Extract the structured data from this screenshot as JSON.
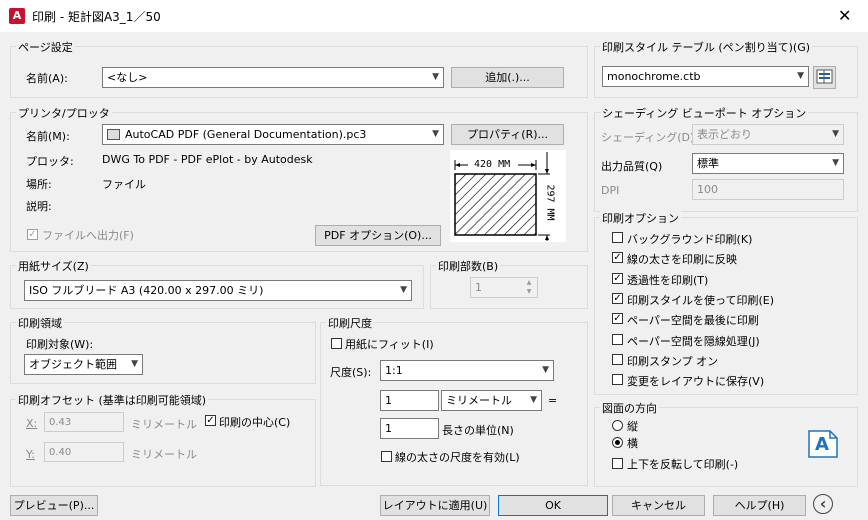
{
  "window": {
    "title": "印刷 - 矩計図A3_1／50",
    "icon_letter": "A",
    "close_glyph": "✕"
  },
  "page_setup": {
    "title": "ページ設定",
    "name_label": "名前(A):",
    "name_value": "<なし>",
    "add_button": "追加(.)..."
  },
  "printer": {
    "title": "プリンタ/プロッタ",
    "name_label": "名前(M):",
    "name_value": "AutoCAD PDF (General Documentation).pc3",
    "properties_button": "プロパティ(R)...",
    "plotter_label": "プロッタ:",
    "plotter_value": "DWG To PDF - PDF ePlot - by Autodesk",
    "location_label": "場所:",
    "location_value": "ファイル",
    "description_label": "説明:",
    "print_to_file_label": "ファイルへ出力(F)",
    "print_to_file_checked": true,
    "pdf_options_button": "PDF オプション(O)...",
    "preview_width": "420 MM",
    "preview_height": "297 MM"
  },
  "paper_size": {
    "title": "用紙サイズ(Z)",
    "value": "ISO フルブリード A3 (420.00 x 297.00 ミリ)"
  },
  "copies": {
    "title": "印刷部数(B)",
    "value": "1"
  },
  "plot_area": {
    "title": "印刷領域",
    "what_label": "印刷対象(W):",
    "what_value": "オブジェクト範囲"
  },
  "plot_scale": {
    "title": "印刷尺度",
    "fit_label": "用紙にフィット(I)",
    "fit_checked": false,
    "scale_label": "尺度(S):",
    "scale_value": "1:1",
    "value1": "1",
    "unit_value": "ミリメートル",
    "equals": "=",
    "value2": "1",
    "units_label": "長さの単位(N)",
    "lineweights_label": "線の太さの尺度を有効(L)",
    "lineweights_checked": false
  },
  "plot_offset": {
    "title": "印刷オフセット (基準は印刷可能領域)",
    "x_label": "X:",
    "x_value": "0.43",
    "x_unit": "ミリメートル",
    "y_label": "Y:",
    "y_value": "0.40",
    "y_unit": "ミリメートル",
    "center_label": "印刷の中心(C)",
    "center_checked": true
  },
  "style_table": {
    "title": "印刷スタイル テーブル (ペン割り当て)(G)",
    "value": "monochrome.ctb"
  },
  "shaded_viewport": {
    "title": "シェーディング ビューポート オプション",
    "shade_label": "シェーディング(D)",
    "shade_value": "表示どおり",
    "quality_label": "出力品質(Q)",
    "quality_value": "標準",
    "dpi_label": "DPI",
    "dpi_value": "100"
  },
  "plot_options": {
    "title": "印刷オプション",
    "items": [
      {
        "label": "バックグラウンド印刷(K)",
        "checked": false
      },
      {
        "label": "線の太さを印刷に反映",
        "checked": true
      },
      {
        "label": "透過性を印刷(T)",
        "checked": true
      },
      {
        "label": "印刷スタイルを使って印刷(E)",
        "checked": true
      },
      {
        "label": "ペーパー空間を最後に印刷",
        "checked": true
      },
      {
        "label": "ペーパー空間を隠線処理(J)",
        "checked": false
      },
      {
        "label": "印刷スタンプ オン",
        "checked": false
      },
      {
        "label": "変更をレイアウトに保存(V)",
        "checked": false
      }
    ]
  },
  "orientation": {
    "title": "図面の方向",
    "portrait_label": "縦",
    "landscape_label": "横",
    "selected": "landscape",
    "upside_down_label": "上下を反転して印刷(-)",
    "upside_down_checked": false,
    "icon_letter": "A"
  },
  "footer": {
    "preview_button": "プレビュー(P)...",
    "apply_button": "レイアウトに適用(U)",
    "ok_button": "OK",
    "cancel_button": "キャンセル",
    "help_button": "ヘルプ(H)",
    "collapse_glyph": "‹"
  }
}
